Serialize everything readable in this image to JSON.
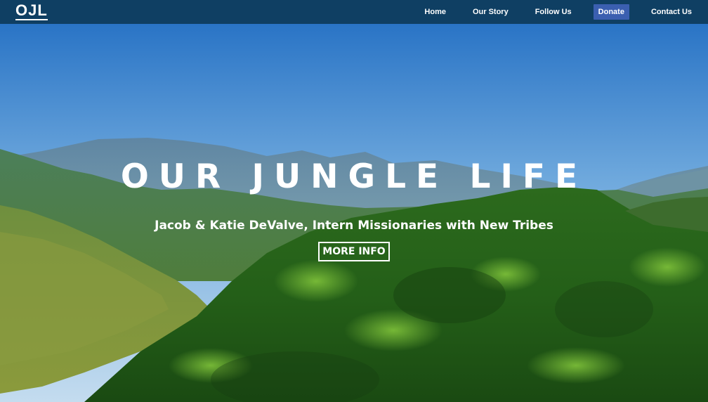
{
  "navbar": {
    "logo": "OJL",
    "items": [
      {
        "label": "Home"
      },
      {
        "label": "Our Story"
      },
      {
        "label": "Follow Us"
      },
      {
        "label": "Donate"
      },
      {
        "label": "Contact Us"
      }
    ],
    "active_color": "#3b5fb0",
    "background": "#0f3f63"
  },
  "hero": {
    "title": "OUR JUNGLE LIFE",
    "subtitle": "Jacob & Katie DeValve, Intern Missionaries with New Tribes",
    "button_label": "MORE INFO"
  },
  "colors": {
    "sky_top": "#1f6fc4",
    "sky_horizon": "#b9d6ec",
    "forest": "#2e6b1f"
  }
}
